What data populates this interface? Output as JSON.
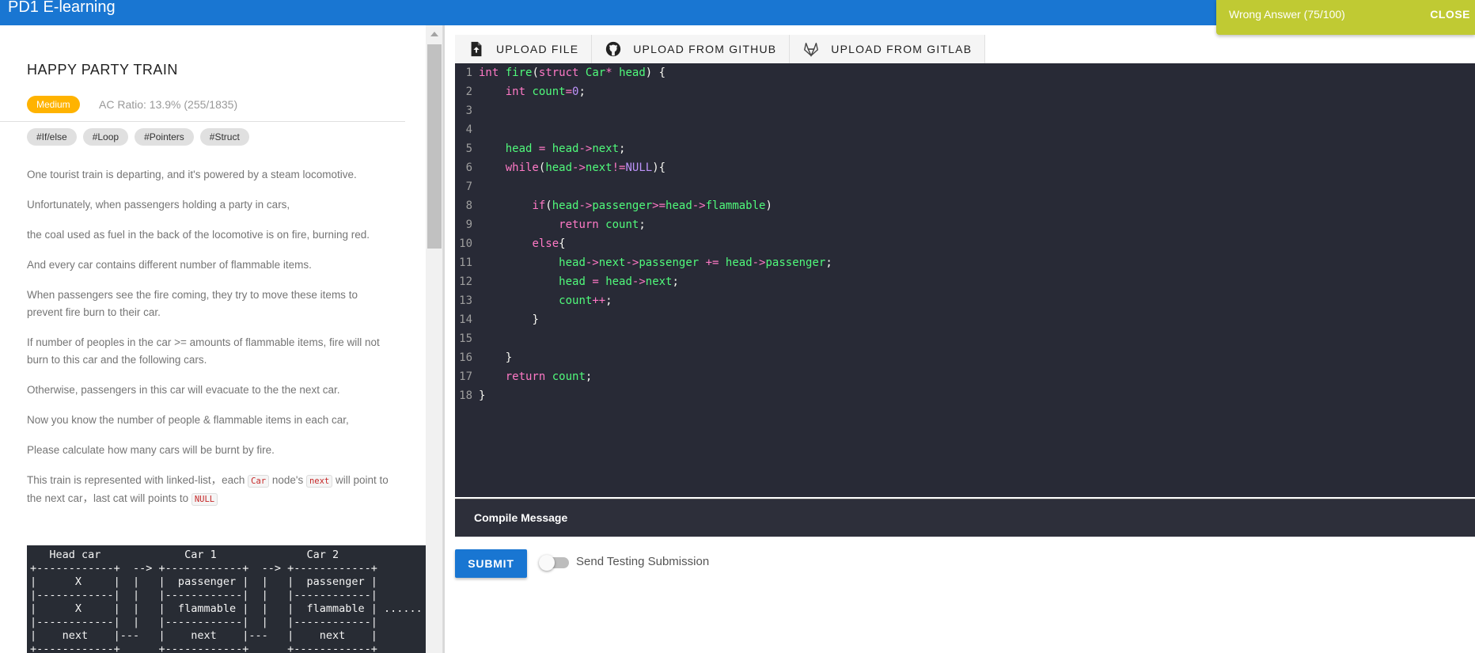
{
  "app": {
    "brand": "PD1 E-learning"
  },
  "toast": {
    "message": "Wrong Answer (75/100)",
    "close_label": "CLOSE"
  },
  "problem": {
    "title": "HAPPY PARTY TRAIN",
    "difficulty": "Medium",
    "ac_ratio": "AC Ratio: 13.9% (255/1835)",
    "tags": [
      "#If/else",
      "#Loop",
      "#Pointers",
      "#Struct"
    ],
    "paragraphs": [
      "One tourist train is departing, and it's powered by a steam locomotive.",
      "Unfortunately, when passengers holding a party in cars,",
      "the coal used as fuel in the back of the locomotive is on fire, burning red.",
      "And every car contains different number of flammable items.",
      "When passengers see the fire coming, they try to move these items to prevent fire burn to their car.",
      "If number of peoples in the car >= amounts of flammable items, fire will not burn to this car and the following cars.",
      "Otherwise, passengers in this car will evacuate to the the next car.",
      "Now you know the number of people & flammable items in each car,",
      "Please calculate how many cars will be burnt by fire."
    ],
    "linked_list": {
      "part1": "This train is represented with linked-list，each ",
      "code1": "Car",
      "part2": " node's ",
      "code2": "next",
      "part3": " will point to the next car，last cat will points to ",
      "code3": "NULL"
    },
    "ascii_diagram": "   Head car             Car 1              Car 2\n+------------+  --> +------------+  --> +------------+        +\n|      X     |  |   |  passenger |  |   |  passenger |        |\n|------------|  |   |------------|  |   |------------|        |\n|      X     |  |   |  flammable |  |   |  flammable | ...... |\n|------------|  |   |------------|  |   |------------|        |\n|    next    |---   |    next    |---   |    next    |        |\n+------------+      +------------+      +------------+        +"
  },
  "toolbar": {
    "upload_file": "UPLOAD FILE",
    "upload_github": "UPLOAD FROM GITHUB",
    "upload_gitlab": "UPLOAD FROM GITLAB"
  },
  "code_lines": [
    "int fire(struct Car* head) {",
    "    int count=0;",
    "",
    "",
    "    head = head->next;",
    "    while(head->next!=NULL){",
    "",
    "        if(head->passenger>=head->flammable)",
    "            return count;",
    "        else{",
    "            head->next->passenger += head->passenger;",
    "            head = head->next;",
    "            count++;",
    "        }",
    "",
    "    }",
    "    return count;",
    "}"
  ],
  "compile": {
    "label": "Compile Message"
  },
  "actions": {
    "submit": "SUBMIT",
    "testing_label": "Send Testing Submission"
  }
}
